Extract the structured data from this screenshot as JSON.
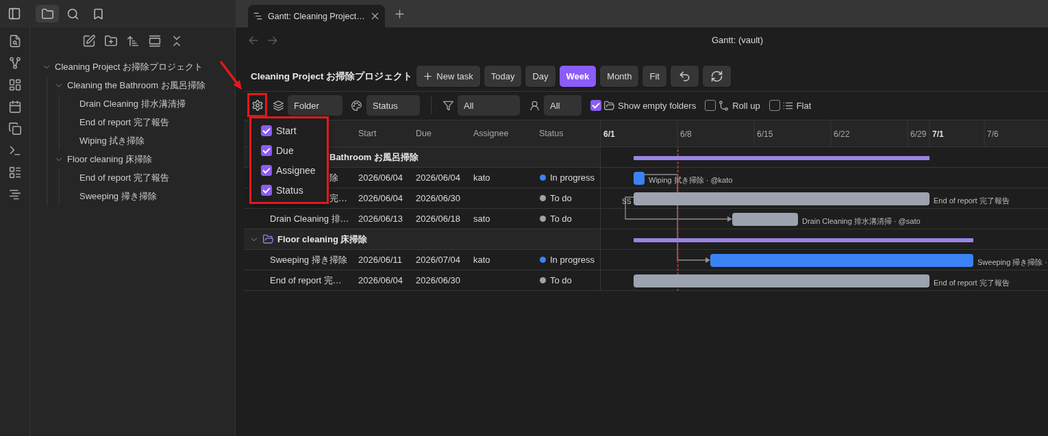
{
  "titlebar": {
    "sidebar_tabs": [
      {
        "kind": "files",
        "selected": true
      },
      {
        "kind": "search",
        "selected": false
      },
      {
        "kind": "bookmarks",
        "selected": false
      }
    ],
    "tabs": [
      {
        "label": "Gantt: Cleaning Project…",
        "selected": true
      }
    ]
  },
  "file_tree": [
    {
      "kind": "folder",
      "name": "Cleaning Project お掃除プロジェクト",
      "expanded": true,
      "children": [
        {
          "kind": "folder",
          "name": "Cleaning the Bathroom お風呂掃除",
          "expanded": true,
          "children": [
            {
              "kind": "file",
              "name": "Drain Cleaning 排水溝清掃"
            },
            {
              "kind": "file",
              "name": "End of report 完了報告"
            },
            {
              "kind": "file",
              "name": "Wiping 拭き掃除"
            }
          ]
        },
        {
          "kind": "folder",
          "name": "Floor cleaning 床掃除",
          "expanded": true,
          "children": [
            {
              "kind": "file",
              "name": "End of report 完了報告"
            },
            {
              "kind": "file",
              "name": "Sweeping 掃き掃除"
            }
          ]
        }
      ]
    }
  ],
  "view": {
    "title": "Gantt: (vault)",
    "project_title": "Cleaning Project お掃除プロジェクト",
    "new_task": "New task",
    "today": "Today",
    "scales": [
      {
        "label": "Day",
        "selected": false
      },
      {
        "label": "Week",
        "selected": true
      },
      {
        "label": "Month",
        "selected": false
      }
    ],
    "fit": "Fit"
  },
  "filters": {
    "settings_button": {
      "highlighted": true,
      "arrow": true
    },
    "group_by": "Folder",
    "color_by": "Status",
    "status_filter": "All",
    "assignee_filter": "All",
    "options": [
      {
        "kind": "folders",
        "label": "Show empty folders",
        "checked": true
      },
      {
        "kind": "rollup",
        "label": "Roll up",
        "checked": false
      },
      {
        "kind": "flat",
        "label": "Flat",
        "checked": false
      }
    ]
  },
  "column_menu": {
    "highlighted": true,
    "items": [
      {
        "label": "Start",
        "checked": true
      },
      {
        "label": "Due",
        "checked": true
      },
      {
        "label": "Assignee",
        "checked": true
      },
      {
        "label": "Status",
        "checked": true
      }
    ]
  },
  "table": {
    "columns": [
      "Start",
      "Due",
      "Assignee",
      "Status"
    ],
    "rows": [
      {
        "kind": "group",
        "name": "Bathroom お風呂掃除",
        "partly_hidden": true
      },
      {
        "kind": "task",
        "name": "除",
        "start": "2026/06/04",
        "due": "2026/06/04",
        "assignee": "kato",
        "status": "In progress",
        "color": "#3b82f6",
        "partly_hidden": true,
        "bar_label": "Wiping 拭き掃除 · @kato",
        "link_out": {
          "kind": "finish_start"
        }
      },
      {
        "kind": "task",
        "name": "完…",
        "start": "2026/06/04",
        "due": "2026/06/30",
        "status": "To do",
        "color": "#9ca3af",
        "partly_hidden": true,
        "bar_label": "End of report 完了報告",
        "link_out": {
          "kind": "start_start",
          "label": "SS"
        }
      },
      {
        "kind": "task",
        "name": "Drain Cleaning 排…",
        "start": "2026/06/13",
        "due": "2026/06/18",
        "assignee": "sato",
        "status": "To do",
        "color": "#9ca3af",
        "partly_hidden": false,
        "bar_label": "Drain Cleaning 排水溝清掃 · @sato",
        "link_in": {
          "kind": "start_start"
        }
      },
      {
        "kind": "group",
        "name": "Floor cleaning 床掃除",
        "expanded": true,
        "partly_hidden": false
      },
      {
        "kind": "task",
        "name": "Sweeping 掃き掃除",
        "start": "2026/06/11",
        "due": "2026/07/04",
        "assignee": "kato",
        "status": "In progress",
        "color": "#3b82f6",
        "partly_hidden": false,
        "bar_label": "Sweeping 掃き掃除 ·",
        "link_in": {
          "kind": "finish_start"
        }
      },
      {
        "kind": "task",
        "name": "End of report 完…",
        "start": "2026/06/04",
        "due": "2026/06/30",
        "status": "To do",
        "color": "#9ca3af",
        "partly_hidden": false,
        "bar_label": "End of report 完了報告"
      }
    ]
  },
  "timeline": {
    "ticks": [
      {
        "label": "6/1",
        "bold": true,
        "today": false
      },
      {
        "label": "6/8",
        "bold": false,
        "today": true
      },
      {
        "label": "6/15",
        "bold": false,
        "today": false
      },
      {
        "label": "6/22",
        "bold": false,
        "today": false
      },
      {
        "label": "6/29",
        "bold": false,
        "today": false
      },
      {
        "label": "7/1",
        "bold": true,
        "today": false
      },
      {
        "label": "7/6",
        "bold": false,
        "today": false
      }
    ]
  }
}
